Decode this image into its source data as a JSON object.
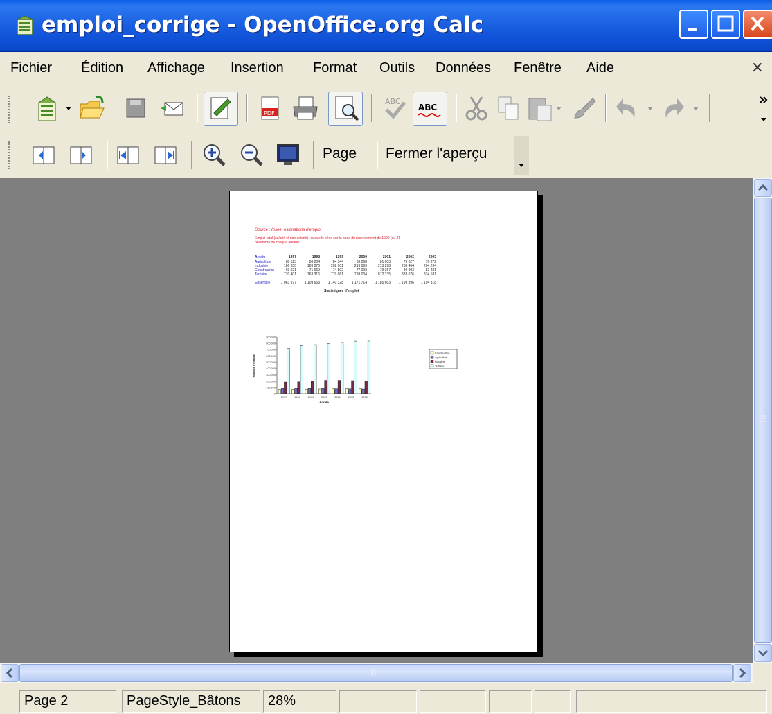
{
  "window": {
    "title": "emploi_corrige - OpenOffice.org Calc"
  },
  "menu": {
    "items": [
      "Fichier",
      "Édition",
      "Affichage",
      "Insertion",
      "Format",
      "Outils",
      "Données",
      "Fenêtre",
      "Aide"
    ],
    "close_symbol": "×"
  },
  "preview_toolbar": {
    "page_label": "Page",
    "close_preview_label": "Fermer l'aperçu"
  },
  "page_content": {
    "source": "Source : Insee, estimations d'emploi",
    "description": "Emploi total (salarié et non salarié) : nouvelle série sur la base du recensement de 1999 (au 31 décembre de chaque année)",
    "table": {
      "header": [
        "Année",
        "1997",
        "1998",
        "1999",
        "2000",
        "2001",
        "2002",
        "2003"
      ],
      "rows": [
        {
          "label": "Agriculture",
          "values": [
            "88 123",
            "86 204",
            "84 344",
            "83 298",
            "81 003",
            "79 027",
            "76 372"
          ]
        },
        {
          "label": "Industrie",
          "values": [
            "186 350",
            "189 276",
            "202 901",
            "213 093",
            "213 298",
            "208 464",
            "204 294"
          ]
        },
        {
          "label": "Construction",
          "values": [
            "69 021",
            "71 669",
            "74 802",
            "77 098",
            "79 367",
            "80 993",
            "82 481"
          ]
        },
        {
          "label": "Tertiaire",
          "values": [
            "720 401",
            "763 316",
            "779 081",
            "798 034",
            "812 135",
            "833 076",
            "834 181"
          ]
        }
      ],
      "total": {
        "label": "Ensemble",
        "values": [
          "1 063 977",
          "1 109 663",
          "1 140 328",
          "1 171 714",
          "1 185 663",
          "1 199 396",
          "1 194 318"
        ]
      }
    },
    "chart_title": "Statistiques d'emploi",
    "chart_ylabel": "Nombre d'emplois",
    "chart_xlabel": "Année",
    "chart_yticks": [
      "900 000",
      "800 000",
      "700 000",
      "600 000",
      "500 000",
      "400 000",
      "300 000",
      "200 000",
      "100 000",
      "0"
    ],
    "chart_categories": [
      "1997",
      "1998",
      "1999",
      "2000",
      "2001",
      "2002",
      "2003"
    ],
    "legend": [
      "Construction",
      "Agriculture",
      "Industrie",
      "Tertiaire"
    ]
  },
  "chart_data": {
    "type": "bar",
    "title": "Statistiques d'emploi",
    "xlabel": "Année",
    "ylabel": "Nombre d'emplois",
    "ylim": [
      0,
      900000
    ],
    "categories": [
      "1997",
      "1998",
      "1999",
      "2000",
      "2001",
      "2002",
      "2003"
    ],
    "legend_position": "right",
    "series": [
      {
        "name": "Construction",
        "values": [
          69021,
          71669,
          74802,
          77098,
          79367,
          80993,
          82481
        ],
        "color": "#ffffc0"
      },
      {
        "name": "Agriculture",
        "values": [
          88123,
          86204,
          84344,
          83298,
          81003,
          79027,
          76372
        ],
        "color": "#6c6cc8"
      },
      {
        "name": "Industrie",
        "values": [
          186350,
          189276,
          202901,
          213093,
          213298,
          208464,
          204294
        ],
        "color": "#7a2848"
      },
      {
        "name": "Tertiaire",
        "values": [
          720401,
          763316,
          779081,
          798034,
          812135,
          833076,
          834181
        ],
        "color": "#d8fcfc"
      }
    ]
  },
  "status": {
    "page": "Page 2",
    "page_style": "PageStyle_Bâtons",
    "zoom": "28%"
  },
  "scroll": {
    "grip": "III"
  }
}
